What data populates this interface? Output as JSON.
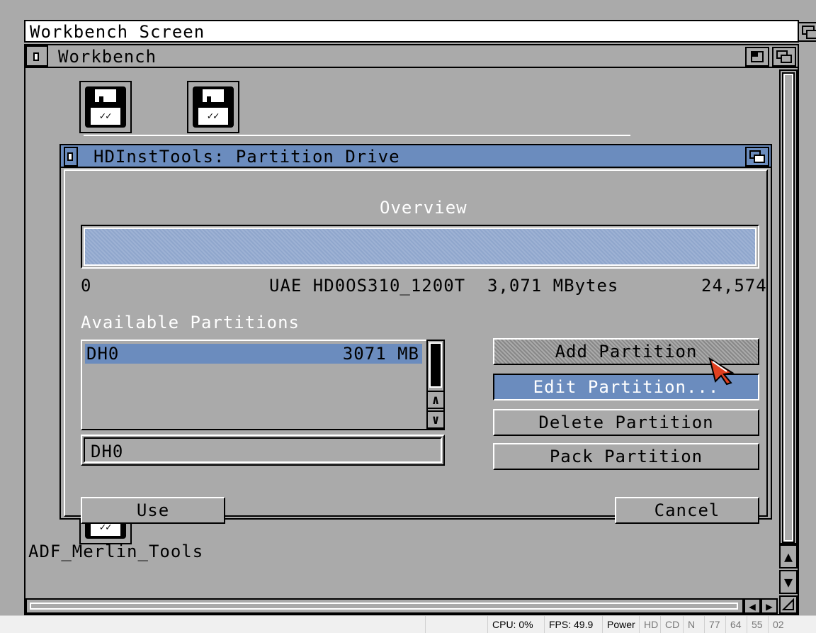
{
  "screen": {
    "title": "Workbench Screen"
  },
  "workbench": {
    "title": "Workbench",
    "icons": [
      {
        "name": "floppy-disk-1"
      },
      {
        "name": "floppy-disk-2"
      },
      {
        "name": "floppy-disk-3",
        "label": "ADF_Merlin_Tools"
      }
    ]
  },
  "dialog": {
    "title": "HDInstTools: Partition Drive",
    "overview": {
      "label": "Overview",
      "start": "0",
      "drive": "UAE HD0OS310̲1200T  3,071 MBytes",
      "end": "24,574"
    },
    "available_label": "Available Partitions",
    "partitions": [
      {
        "name": "DH0",
        "size": "3071 MB",
        "selected": true
      }
    ],
    "partition_name_value": "DH0",
    "buttons": {
      "add": "Add Partition",
      "edit": "Edit Partition...",
      "delete": "Delete Partition",
      "pack": "Pack Partition",
      "use": "Use",
      "cancel": "Cancel"
    }
  },
  "statusbar": {
    "cpu": "CPU: 0%",
    "fps": "FPS: 49.9",
    "power": "Power",
    "hd": "HD",
    "cd": "CD",
    "n": "N",
    "t1": "77",
    "t2": "64",
    "t3": "55",
    "t4": "02"
  },
  "colors": {
    "screen_bg": "#aaaaaa",
    "accent": "#6b8cbe"
  }
}
